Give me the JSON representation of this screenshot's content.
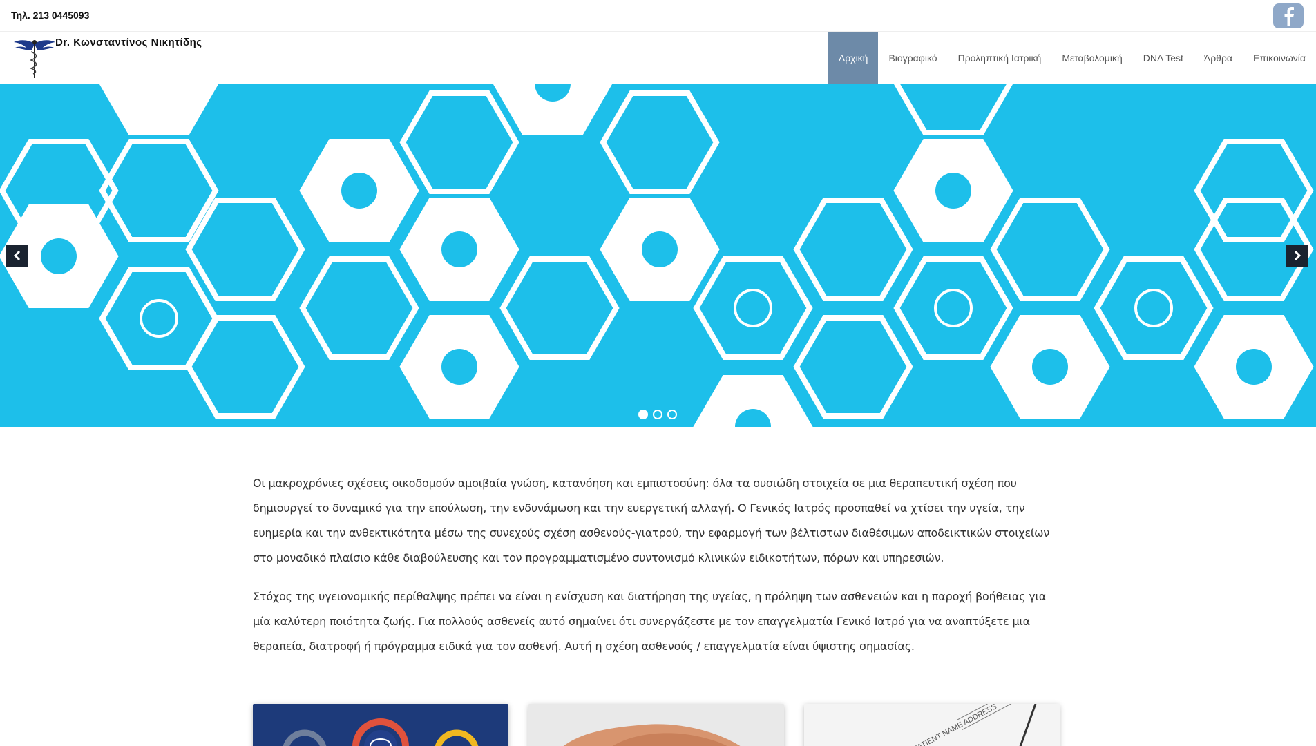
{
  "topbar": {
    "phone": "Τηλ. 213 0445093",
    "social_icon": "facebook-icon"
  },
  "header": {
    "brand": "Dr. Κωνσταντίνος Νικητίδης",
    "logo_icon": "caduceus-wings-icon"
  },
  "nav": {
    "items": [
      {
        "label": "Αρχική",
        "active": true
      },
      {
        "label": "Βιογραφικό",
        "active": false
      },
      {
        "label": "Προληπτική Ιατρική",
        "active": false
      },
      {
        "label": "Μεταβολομική",
        "active": false
      },
      {
        "label": "DNA Test",
        "active": false
      },
      {
        "label": "Άρθρα",
        "active": false
      },
      {
        "label": "Επικοινωνία",
        "active": false
      }
    ]
  },
  "slider": {
    "icons": [
      "pills-icon",
      "caduceus-icon",
      "medical-cross-icon",
      "drop-icon",
      "heartbeat-icon",
      "gender-icon",
      "hospital-h-icon",
      "molecule-icon",
      "star-of-life-icon",
      "first-aid-kit-icon",
      "thermometer-icon",
      "wheelchair-icon",
      "flask-icon"
    ],
    "slide_count": 3,
    "active_slide": 1,
    "background": "#1dbfea"
  },
  "content": {
    "p1": "Οι μακροχρόνιες σχέσεις οικοδομούν αμοιβαία γνώση, κατανόηση και εμπιστοσύνη: όλα τα ουσιώδη στοιχεία σε μια θεραπευτική σχέση που δημιουργεί το δυναμικό για την επούλωση, την ενδυνάμωση και την ευεργετική αλλαγή. Ο Γενικός Ιατρός προσπαθεί να χτίσει την υγεία, την ευημερία και την ανθεκτικότητα μέσω της συνεχούς σχέση ασθενούς-γιατρού, την εφαρμογή των βέλτιστων διαθέσιμων αποδεικτικών στοιχείων στο μοναδικό πλαίσιο κάθε διαβούλευσης και τον προγραμματισμένο συντονισμό κλινικών ειδικοτήτων, πόρων και υπηρεσιών.",
    "p2": "Στόχος της υγειονομικής περίθαλψης πρέπει να είναι η ενίσχυση και διατήρηση της υγείας, η πρόληψη των ασθενειών και η παροχή βοήθειας για μία καλύτερη ποιότητα ζωής. Για πολλούς ασθενείς αυτό σημαίνει ότι συνεργάζεστε με τον επαγγελματία Γενικό Ιατρό για να αναπτύξετε μια θεραπεία, διατροφή ή πρόγραμμα ειδικά για τον ασθενή. Αυτή η σχέση ασθενούς / επαγγελματία είναι ύψιστης σημασίας."
  },
  "cards": {
    "card3_text": "PATIENT NAME ADDRESS"
  },
  "colors": {
    "nav_active": "#6d8aa8",
    "facebook": "#8fa8c8",
    "arrow_bg": "#1a2330"
  }
}
